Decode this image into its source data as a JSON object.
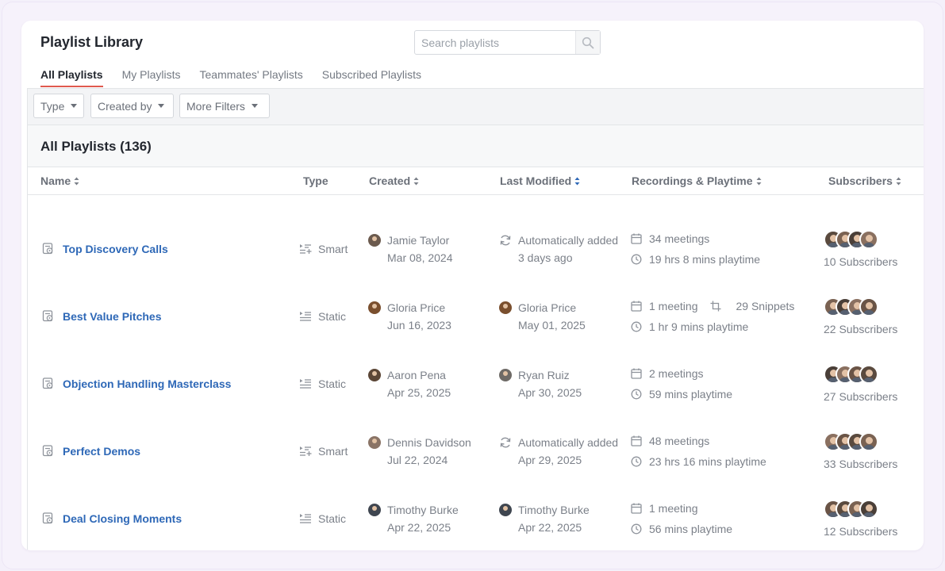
{
  "header": {
    "title": "Playlist Library",
    "search_placeholder": "Search playlists"
  },
  "tabs": [
    {
      "label": "All Playlists",
      "active": true
    },
    {
      "label": "My Playlists",
      "active": false
    },
    {
      "label": "Teammates' Playlists",
      "active": false
    },
    {
      "label": "Subscribed Playlists",
      "active": false
    }
  ],
  "filters": [
    {
      "label": "Type"
    },
    {
      "label": "Created by"
    },
    {
      "label": "More Filters"
    }
  ],
  "table": {
    "count_title": "All Playlists (136)",
    "columns": {
      "name": "Name",
      "type": "Type",
      "created": "Created",
      "last_modified": "Last Modified",
      "recordings": "Recordings & Playtime",
      "subscribers": "Subscribers"
    },
    "rows": [
      {
        "name": "Top Discovery Calls",
        "type": "Smart",
        "type_icon": "smart-list-icon",
        "created_by": "Jamie Taylor",
        "created_date": "Mar 08, 2024",
        "created_avatar": "#6b5a4e",
        "modified_by": "Automatically added",
        "modified_date": "3 days ago",
        "modified_auto": true,
        "modified_avatar": "",
        "meetings": "34 meetings",
        "snippets": "",
        "playtime": "19 hrs 8 mins playtime",
        "subscribers": "10 Subscribers"
      },
      {
        "name": "Best Value Pitches",
        "type": "Static",
        "type_icon": "static-list-icon",
        "created_by": "Gloria Price",
        "created_date": "Jun 16, 2023",
        "created_avatar": "#7a4f2e",
        "modified_by": "Gloria Price",
        "modified_date": "May 01, 2025",
        "modified_auto": false,
        "modified_avatar": "#7a4f2e",
        "meetings": "1 meeting",
        "snippets": "29 Snippets",
        "playtime": "1 hr 9 mins playtime",
        "subscribers": "22 Subscribers"
      },
      {
        "name": "Objection Handling Masterclass",
        "type": "Static",
        "type_icon": "static-list-icon",
        "created_by": "Aaron Pena",
        "created_date": "Apr 25, 2025",
        "created_avatar": "#5b4636",
        "modified_by": "Ryan Ruiz",
        "modified_date": "Apr 30, 2025",
        "modified_auto": false,
        "modified_avatar": "#6e6a66",
        "meetings": "2 meetings",
        "snippets": "",
        "playtime": "59 mins playtime",
        "subscribers": "27 Subscribers"
      },
      {
        "name": "Perfect Demos",
        "type": "Smart",
        "type_icon": "smart-list-icon",
        "created_by": "Dennis Davidson",
        "created_date": "Jul 22, 2024",
        "created_avatar": "#8a7466",
        "modified_by": "Automatically added",
        "modified_date": "Apr 29, 2025",
        "modified_auto": true,
        "modified_avatar": "",
        "meetings": "48 meetings",
        "snippets": "",
        "playtime": "23 hrs 16 mins playtime",
        "subscribers": "33 Subscribers"
      },
      {
        "name": "Deal Closing Moments",
        "type": "Static",
        "type_icon": "static-list-icon",
        "created_by": "Timothy Burke",
        "created_date": "Apr 22, 2025",
        "created_avatar": "#3f4650",
        "modified_by": "Timothy Burke",
        "modified_date": "Apr 22, 2025",
        "modified_auto": false,
        "modified_avatar": "#3f4650",
        "meetings": "1 meeting",
        "snippets": "",
        "playtime": "56 mins playtime",
        "subscribers": "12 Subscribers"
      }
    ]
  },
  "colors": {
    "accent": "#e05a4e",
    "link": "#2e68b7",
    "sort_active": "#2e68b7",
    "background": "#f4f0fa"
  }
}
